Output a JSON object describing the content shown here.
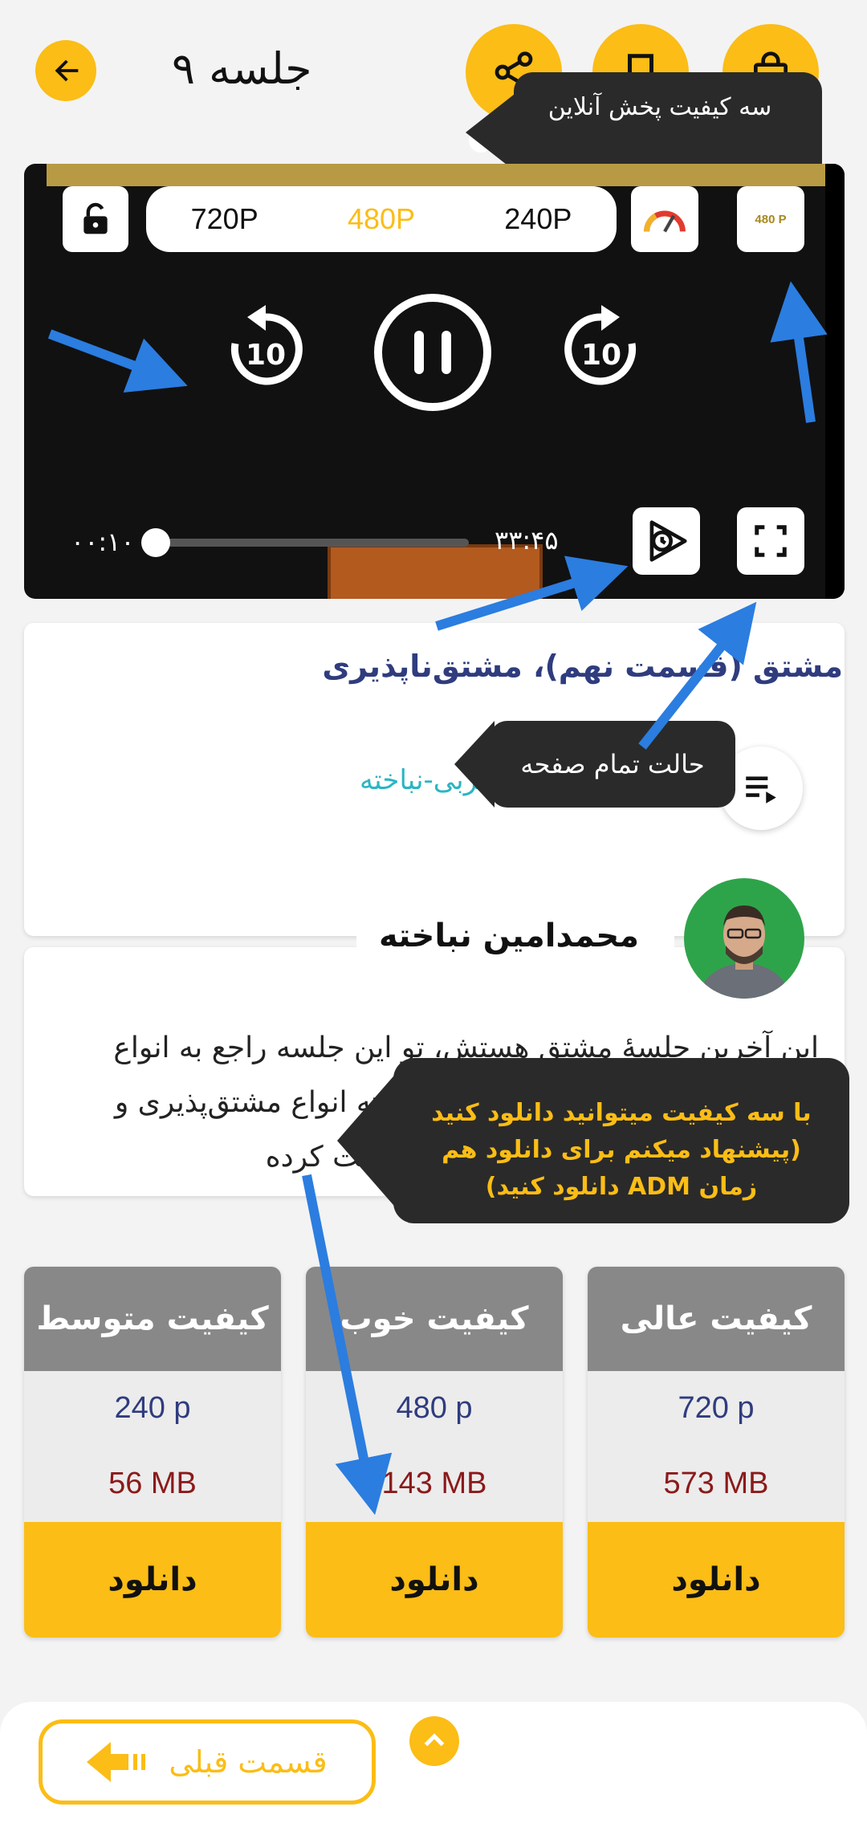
{
  "header": {
    "title": "جلسه ۹",
    "back_icon": "arrow-left-icon",
    "share_icon": "share-icon",
    "bookmark_icon": "bookmark-icon",
    "cart_icon": "shopping-bag-icon"
  },
  "tooltips": {
    "quality": "سه کیفیت پخش آنلاین",
    "fullscreen": "حالت تمام صفحه",
    "download": "با سه کیفیت میتوانید دانلود کنید (پیشنهاد میکنم برای دانلود هم زمان ADM دانلود کنید)"
  },
  "player": {
    "qualities": [
      "720P",
      "480P",
      "240P"
    ],
    "active_quality": "480P",
    "quality_badge": "480 P",
    "elapsed": "۰۰:۱۰",
    "duration": "۳۳:۴۵",
    "progress": 0.005,
    "skip_seconds": "10"
  },
  "lesson": {
    "title": "مشتق (قسمت نهم)، مشتق‌ناپذیری",
    "course": "مشتق ریاضی تجربی-نباخته",
    "teacher": "محمدامین نباخته",
    "description": "این آخرین جلسهٔ مشتق هستش، تو این جلسه راجع به انواع نقاط مشتق‌ناپذیر صحبت می‌کنیم، البته انواع مشتق‌پذیری و مشتق‌ناپذیری رو در ابتدای مشتق صحبت کرده"
  },
  "downloads": [
    {
      "label": "کیفیت عالی",
      "resolution": "720 p",
      "size": "573 MB",
      "button": "دانلود"
    },
    {
      "label": "کیفیت خوب",
      "resolution": "480 p",
      "size": "143 MB",
      "button": "دانلود"
    },
    {
      "label": "کیفیت متوسط",
      "resolution": "240 p",
      "size": "56 MB",
      "button": "دانلود"
    }
  ],
  "footer": {
    "prev_label": "قسمت قبلی"
  },
  "colors": {
    "accent": "#fbbd16",
    "title_blue": "#2f3c7e",
    "link_teal": "#2bb5c4",
    "size_red": "#8b1a1a",
    "arrow_blue": "#2b7de0"
  }
}
